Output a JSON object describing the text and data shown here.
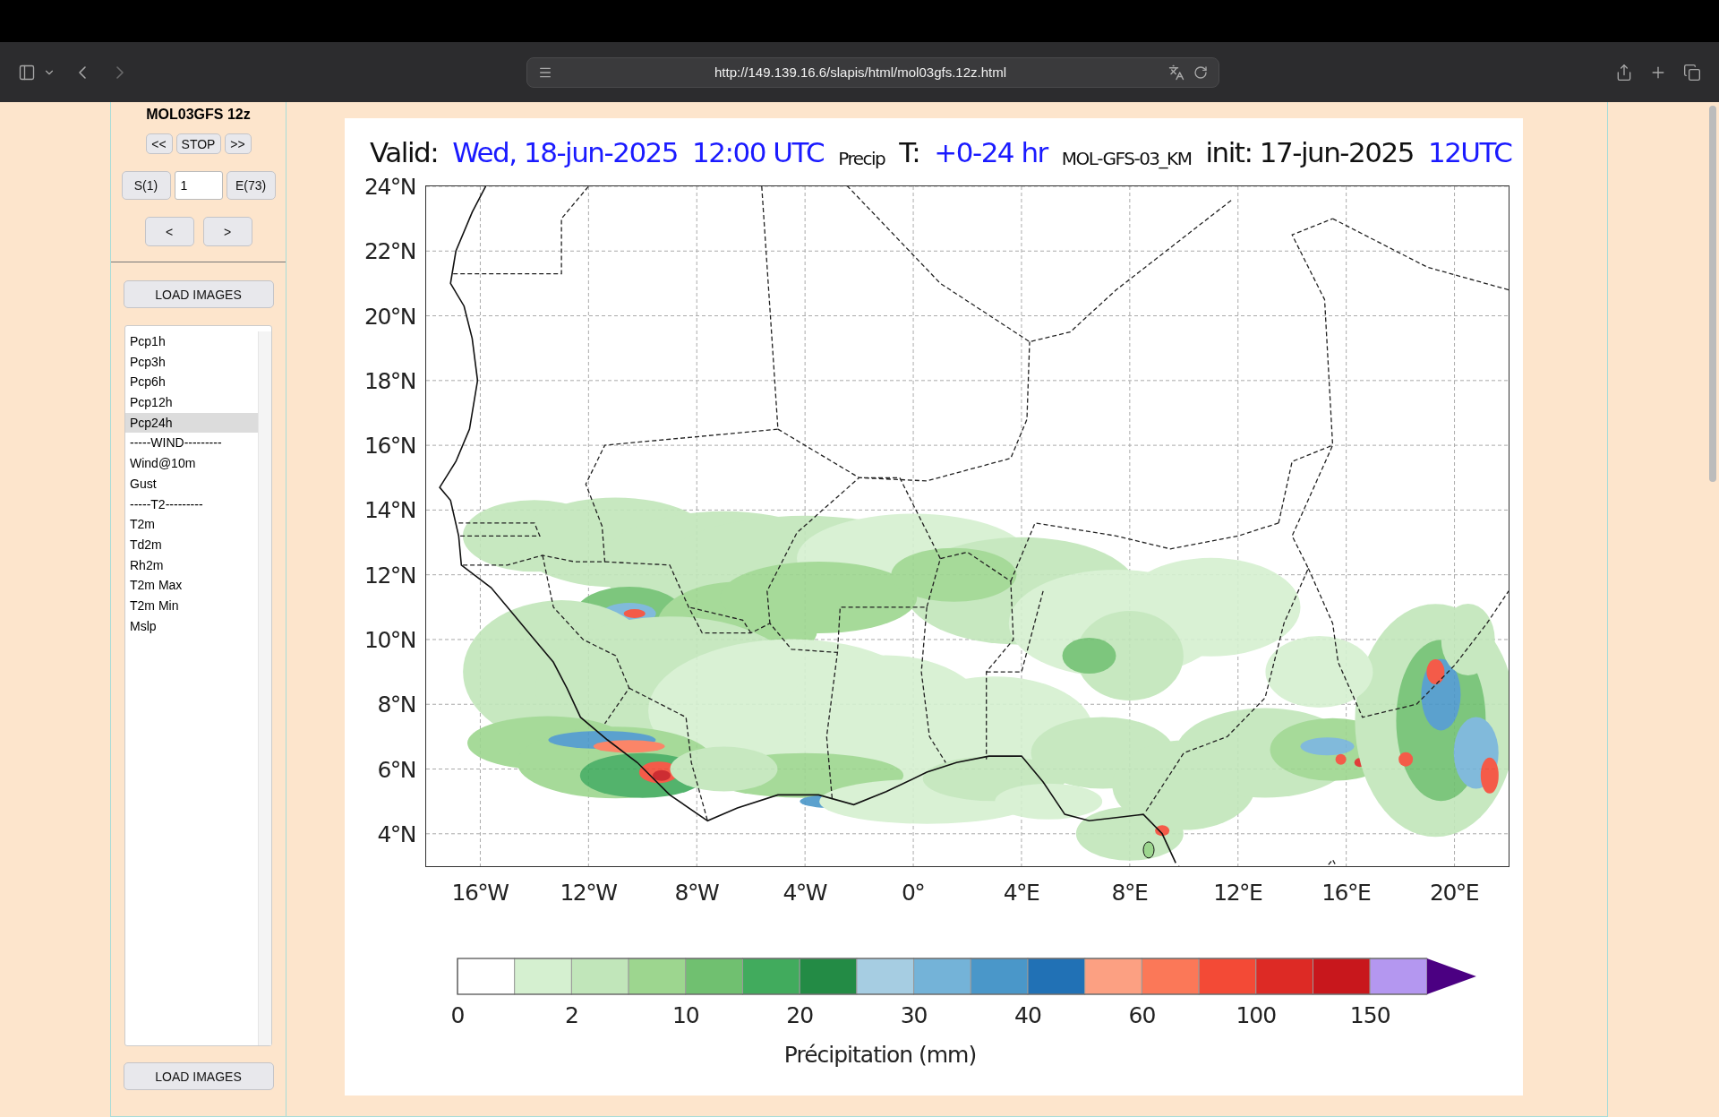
{
  "browser": {
    "url": "http://149.139.16.6/slapis/html/mol03gfs.12z.html"
  },
  "sidebar": {
    "title": "MOL03GFS 12z",
    "play_buttons": [
      "<<",
      "STOP",
      ">>"
    ],
    "start_button": "S(1)",
    "frame_field": {
      "value": "1"
    },
    "end_button": "E(73)",
    "step_buttons": [
      "<",
      ">"
    ],
    "load_button_top": "LOAD IMAGES",
    "variables": [
      {
        "label": "Pcp1h",
        "selected": false
      },
      {
        "label": "Pcp3h",
        "selected": false
      },
      {
        "label": "Pcp6h",
        "selected": false
      },
      {
        "label": "Pcp12h",
        "selected": false
      },
      {
        "label": "Pcp24h",
        "selected": true
      },
      {
        "label": "-----WIND---------",
        "selected": false
      },
      {
        "label": "Wind@10m",
        "selected": false
      },
      {
        "label": "Gust",
        "selected": false
      },
      {
        "label": "-----T2---------",
        "selected": false
      },
      {
        "label": "T2m",
        "selected": false
      },
      {
        "label": "Td2m",
        "selected": false
      },
      {
        "label": "Rh2m",
        "selected": false
      },
      {
        "label": "T2m Max",
        "selected": false
      },
      {
        "label": "T2m Min",
        "selected": false
      },
      {
        "label": "Mslp",
        "selected": false
      }
    ],
    "load_button_bottom": "LOAD IMAGES"
  },
  "map": {
    "title_parts": [
      {
        "kind": "label",
        "text": "Valid:"
      },
      {
        "kind": "value",
        "text": "Wed, 18-jun-2025"
      },
      {
        "kind": "value",
        "text": "12:00 UTC"
      },
      {
        "kind": "small",
        "text": "Precip"
      },
      {
        "kind": "label",
        "text": "T:"
      },
      {
        "kind": "value",
        "text": "+0-24 hr"
      },
      {
        "kind": "small",
        "text": "MOL-GFS-03_KM"
      },
      {
        "kind": "label",
        "text": "init: 17-jun-2025"
      },
      {
        "kind": "value",
        "text": "12UTC"
      }
    ],
    "lat_labels": [
      "24°N",
      "22°N",
      "20°N",
      "18°N",
      "16°N",
      "14°N",
      "12°N",
      "10°N",
      "8°N",
      "6°N",
      "4°N"
    ],
    "lon_labels": [
      "16°W",
      "12°W",
      "8°W",
      "4°W",
      "0°",
      "4°E",
      "8°E",
      "12°E",
      "16°E",
      "20°E"
    ],
    "colorbar": {
      "segments": [
        {
          "color": "#ffffff"
        },
        {
          "color": "#d5f0d0"
        },
        {
          "color": "#c1e6ba"
        },
        {
          "color": "#9dd68f"
        },
        {
          "color": "#70c070"
        },
        {
          "color": "#41ab5d"
        },
        {
          "color": "#238b45"
        },
        {
          "color": "#a6cde2"
        },
        {
          "color": "#74b3d8"
        },
        {
          "color": "#4a97c9"
        },
        {
          "color": "#2171b5"
        },
        {
          "color": "#fca082"
        },
        {
          "color": "#fb7858"
        },
        {
          "color": "#f34a36"
        },
        {
          "color": "#dd2a25"
        },
        {
          "color": "#c8171c"
        },
        {
          "color": "#b497f0"
        },
        {
          "kind": "arrow",
          "color": "#4b0082"
        }
      ],
      "tick_labels": [
        "0",
        "2",
        "10",
        "20",
        "30",
        "40",
        "60",
        "100",
        "150"
      ],
      "label": "Précipitation (mm)"
    }
  }
}
